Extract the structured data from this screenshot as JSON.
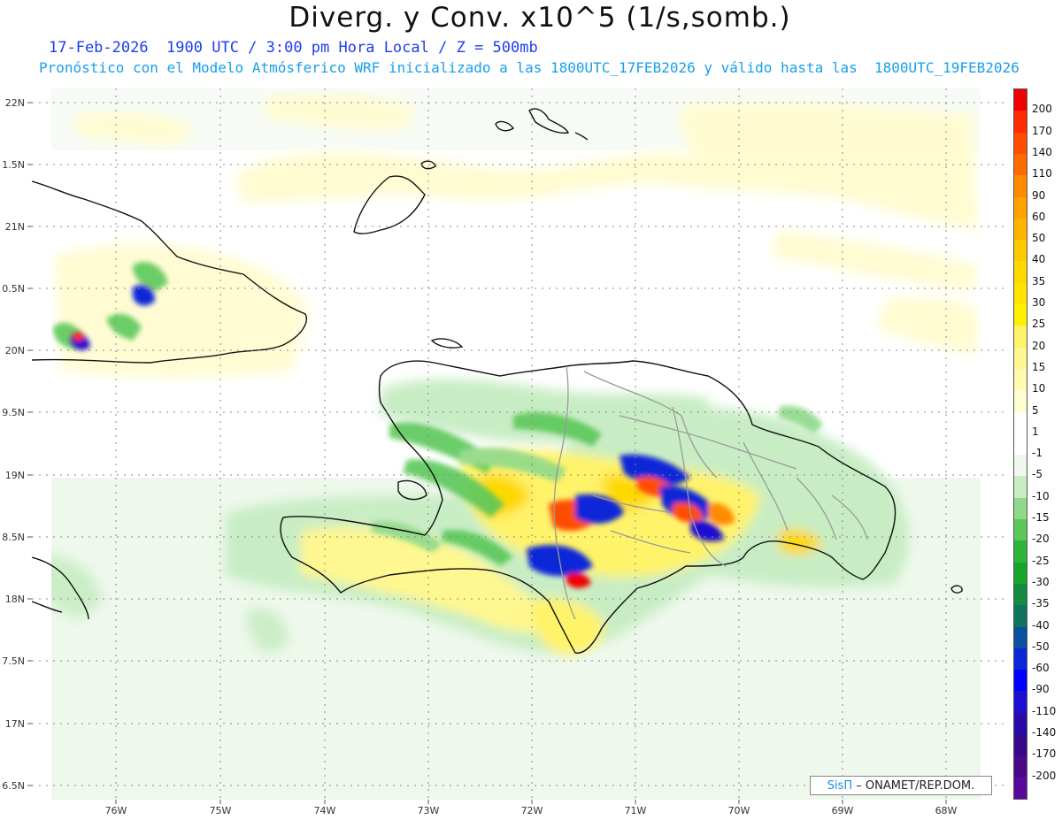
{
  "header": {
    "title": "Diverg. y Conv. x10^5 (1/s,somb.)",
    "subtitle_line1": "17-Feb-2026  1900 UTC / 3:00 pm Hora Local / Z = 500mb",
    "subtitle_line2": "Pronóstico con el Modelo Atmósferico WRF inicializado a las 1800UTC_17FEB2026 y válido hasta las  1800UTC_19FEB2026"
  },
  "axes": {
    "lon_labels": [
      "76W",
      "75W",
      "74W",
      "73W",
      "72W",
      "71W",
      "70W",
      "69W",
      "68W"
    ],
    "lat_labels": [
      "22N",
      "1.5N",
      "21N",
      "0.5N",
      "20N",
      "9.5N",
      "19N",
      "8.5N",
      "18N",
      "7.5N",
      "17N",
      "6.5N"
    ]
  },
  "colorbar": {
    "labels": [
      "200",
      "170",
      "140",
      "110",
      "90",
      "60",
      "50",
      "40",
      "35",
      "30",
      "25",
      "20",
      "15",
      "10",
      "5",
      "1",
      "-1",
      "-5",
      "-10",
      "-15",
      "-20",
      "-25",
      "-30",
      "-35",
      "-40",
      "-50",
      "-60",
      "-90",
      "-110",
      "-140",
      "-170",
      "-200"
    ],
    "colors": [
      "#f00000",
      "#ff2a00",
      "#ff4d00",
      "#ff6a00",
      "#ff8c00",
      "#ffa200",
      "#ffb400",
      "#ffc800",
      "#ffd800",
      "#ffe400",
      "#fff000",
      "#fff36b",
      "#fff78f",
      "#fffab0",
      "#fffcd0",
      "#ffffff",
      "#ffffff",
      "#eef8ec",
      "#c8edc4",
      "#8fd98a",
      "#5cc85a",
      "#2eb63a",
      "#17a62c",
      "#138c40",
      "#10735e",
      "#0a4fa0",
      "#0a28d8",
      "#0000ff",
      "#1e10d0",
      "#2a0aa8",
      "#36088e",
      "#4a0a88",
      "#5a0a9a"
    ]
  },
  "credit": {
    "brand": "SisΠ",
    "text": " – ONAMET/REP.DOM."
  }
}
